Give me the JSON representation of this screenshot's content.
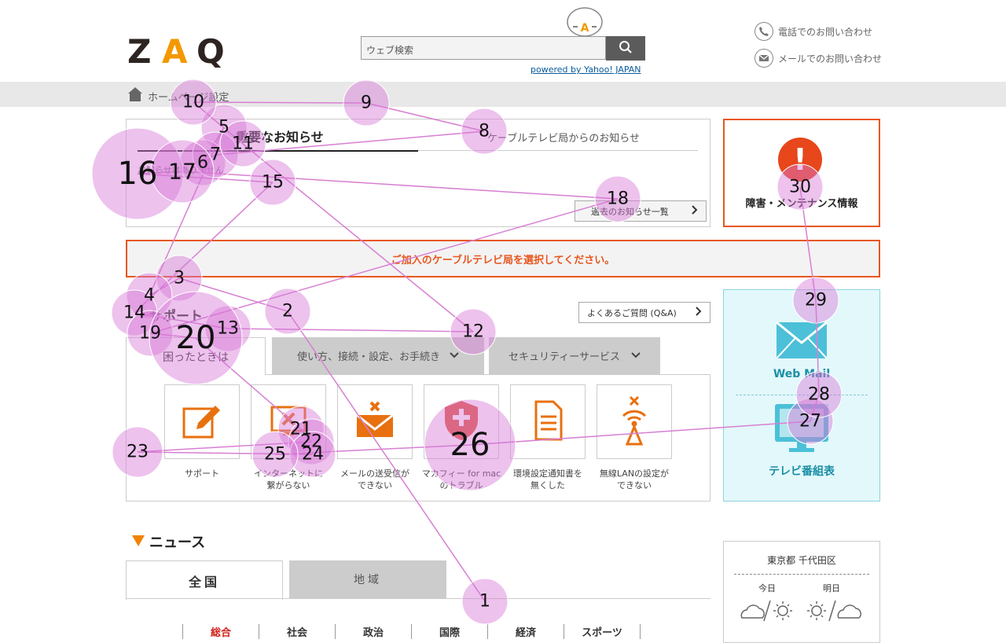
{
  "header": {
    "logo_text": "ZAQ",
    "search_placeholder": "ウェブ検索",
    "powered_by": "powered by Yahoo! JAPAN",
    "contact_phone": "電話でのお問い合わせ",
    "contact_mail": "メールでのお問い合わせ",
    "colors": {
      "logo": "#2d2421",
      "logo_accent": "#f39800",
      "accent": "#e8561e"
    }
  },
  "breadcrumb": {
    "label": "ホームページ設定"
  },
  "notice": {
    "tab_important": "重要なお知らせ",
    "tab_cable": "ケーブルテレビ局からのお知らせ",
    "empty_text": "お知らせはありません",
    "past_button": "過去のお知らせ一覧"
  },
  "maintenance": {
    "label": "障害・メンテナンス情報"
  },
  "select_station": "ご加入のケーブルテレビ局を選択してください。",
  "support": {
    "title": "サポート",
    "faq_button": "よくあるご質問 (Q&A)",
    "tabs": [
      "困ったときは",
      "使い方、接続・設定、お手続き",
      "セキュリティーサービス"
    ],
    "tiles": [
      {
        "line1": "サポート",
        "line2": ""
      },
      {
        "line1": "インターネットに",
        "line2": "繋がらない"
      },
      {
        "line1": "メールの送受信が",
        "line2": "できない"
      },
      {
        "line1": "マカフィー for mac",
        "line2": "のトラブル"
      },
      {
        "line1": "環境設定通知書を",
        "line2": "無くした"
      },
      {
        "line1": "無線LANの設定が",
        "line2": "できない"
      }
    ]
  },
  "side": {
    "webmail": "Web Mail",
    "tv_guide": "テレビ番組表"
  },
  "news": {
    "title": "ニュース",
    "tab_all": "全国",
    "tab_region": "地域",
    "categories": [
      "総合",
      "社会",
      "政治",
      "国際",
      "経済",
      "スポーツ"
    ]
  },
  "weather": {
    "location": "東京都 千代田区",
    "today": "今日",
    "tomorrow": "明日"
  },
  "gaze_points": [
    {
      "n": 1,
      "r": 29
    },
    {
      "n": 2,
      "r": 29
    },
    {
      "n": 3,
      "r": 29
    },
    {
      "n": 4,
      "r": 29
    },
    {
      "n": 5,
      "r": 29
    },
    {
      "n": 6,
      "r": 29
    },
    {
      "n": 7,
      "r": 29
    },
    {
      "n": 8,
      "r": 29
    },
    {
      "n": 9,
      "r": 29
    },
    {
      "n": 10,
      "r": 29
    },
    {
      "n": 11,
      "r": 29
    },
    {
      "n": 12,
      "r": 29
    },
    {
      "n": 13,
      "r": 29
    },
    {
      "n": 14,
      "r": 29
    },
    {
      "n": 15,
      "r": 29
    },
    {
      "n": 16,
      "r": 58
    },
    {
      "n": 17,
      "r": 40
    },
    {
      "n": 18,
      "r": 29
    },
    {
      "n": 19,
      "r": 29
    },
    {
      "n": 20,
      "r": 59
    },
    {
      "n": 21,
      "r": 29
    },
    {
      "n": 22,
      "r": 29
    },
    {
      "n": 23,
      "r": 32
    },
    {
      "n": 24,
      "r": 29
    },
    {
      "n": 25,
      "r": 29
    },
    {
      "n": 26,
      "r": 58
    },
    {
      "n": 27,
      "r": 29
    },
    {
      "n": 28,
      "r": 29
    },
    {
      "n": 29,
      "r": 29
    },
    {
      "n": 30,
      "r": 29
    }
  ]
}
